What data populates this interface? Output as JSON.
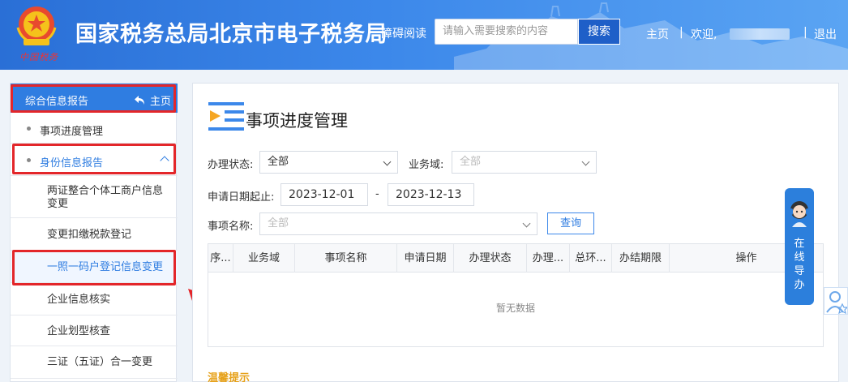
{
  "header": {
    "site_title": "国家税务总局北京市电子税务局",
    "emblem_caption": "中国税务",
    "accessible_read": "障碍阅读",
    "search_placeholder": "请输入需要搜索的内容",
    "search_button": "搜索",
    "home": "主页",
    "separator": "|",
    "welcome": "欢迎,",
    "logout": "退出"
  },
  "sidebar": {
    "title": "综合信息报告",
    "home_link": "主页",
    "items": [
      {
        "label": "事项进度管理"
      },
      {
        "label": "身份信息报告"
      }
    ],
    "subitems": [
      {
        "label": "两证整合个体工商户信息变更"
      },
      {
        "label": "变更扣缴税款登记"
      },
      {
        "label": "一照一码户登记信息变更"
      },
      {
        "label": "企业信息核实"
      },
      {
        "label": "企业划型核查"
      },
      {
        "label": "三证（五证）合一变更"
      }
    ]
  },
  "main": {
    "page_title": "事项进度管理",
    "filters": {
      "status_label": "办理状态:",
      "status_value": "全部",
      "domain_label": "业务域:",
      "domain_value": "全部",
      "date_label": "申请日期起止:",
      "date_from": "2023-12-01",
      "date_sep": "-",
      "date_to": "2023-12-13",
      "item_label": "事项名称:",
      "item_value": "全部",
      "query_button": "查询"
    },
    "table": {
      "columns": [
        "序...",
        "业务域",
        "事项名称",
        "申请日期",
        "办理状态",
        "办理...",
        "总环...",
        "办结期限",
        "操作"
      ],
      "empty_text": "暂无数据"
    },
    "tips_title": "温馨提示"
  },
  "online_guide": {
    "text": [
      "在",
      "线",
      "导",
      "办"
    ]
  },
  "colors": {
    "header_blue": "#2a6fd6",
    "accent_blue": "#2f7de1",
    "highlight_red": "#e3262a",
    "tips_orange": "#e6a11a"
  }
}
